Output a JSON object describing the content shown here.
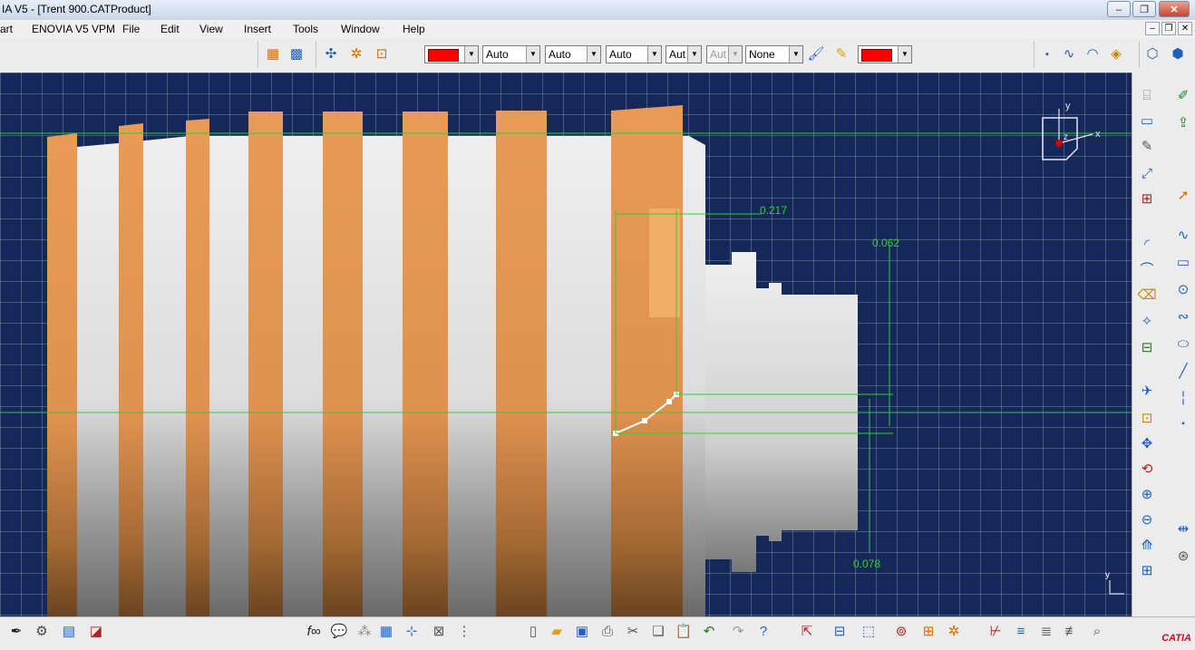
{
  "window": {
    "title": "IA V5 - [Trent 900.CATProduct]",
    "controls": {
      "minimize": "–",
      "restore": "❐",
      "close": "✕"
    }
  },
  "menubar": {
    "items": [
      "art",
      "ENOVIA V5 VPM",
      "File",
      "Edit",
      "View",
      "Insert",
      "Tools",
      "Window",
      "Help"
    ],
    "mdi": {
      "minimize": "–",
      "restore": "❐",
      "close": "✕"
    }
  },
  "properties_toolbar": {
    "fill_color": "#ff0000",
    "transparency": "Auto",
    "line_thickness": "Auto",
    "line_type": "Auto",
    "point_symbol": "Aut",
    "rendering_style": "Aut",
    "layer": "None",
    "stroke_color": "#ff0000"
  },
  "sketch": {
    "dimensions": {
      "top_width": "0.217",
      "right_height": "0.062",
      "bottom_height": "0.078"
    },
    "compass_axes": {
      "x": "x",
      "y": "y",
      "z": "z"
    },
    "view_axis": "y"
  },
  "colors": {
    "background": "#14285a",
    "grid": "#ffffff",
    "dimension": "#2fd12f",
    "blade": "#e0924f",
    "shaft": "#d8d8d8"
  },
  "logo": {
    "text": "CATIA"
  }
}
